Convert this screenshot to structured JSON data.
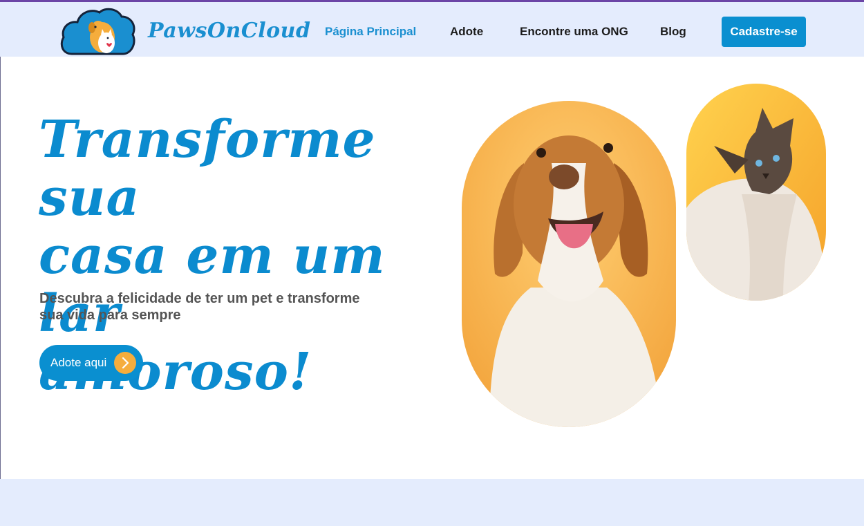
{
  "brand": {
    "name": "PawsOnCloud",
    "logo_icon": "cloud-dog-cat-logo-icon"
  },
  "nav": {
    "items": [
      {
        "label": "Página Principal",
        "active": true
      },
      {
        "label": "Adote",
        "active": false
      },
      {
        "label": "Encontre uma ONG",
        "active": false
      },
      {
        "label": "Blog",
        "active": false
      }
    ],
    "signup_label": "Cadastre-se"
  },
  "hero": {
    "title_lines": [
      "Transforme sua",
      "casa em um lar",
      "amoroso!"
    ],
    "subtitle_lines": [
      "Descubra a felicidade de ter um pet e transforme",
      "sua vida para sempre"
    ],
    "cta_label": "Adote aqui",
    "cta_icon": "chevron-right-icon"
  },
  "images": {
    "dog_icon": "dog-photo",
    "cat_icon": "cat-photo"
  },
  "colors": {
    "primary": "#0a8fd0",
    "accent": "#f5ad3c",
    "header_bg": "#e4ecfd",
    "top_border": "#6b45a6",
    "subtitle": "#545454"
  }
}
